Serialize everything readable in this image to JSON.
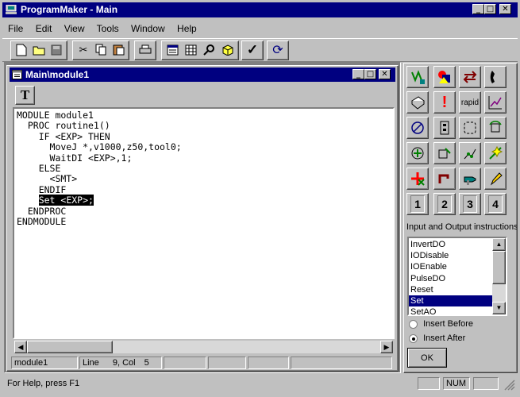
{
  "app": {
    "title": "ProgramMaker - Main"
  },
  "menu": [
    "File",
    "Edit",
    "View",
    "Tools",
    "Window",
    "Help"
  ],
  "toolbar": {
    "icons": [
      "new-file-icon",
      "open-folder-icon",
      "save-icon",
      "cut-icon",
      "copy-icon",
      "paste-icon",
      "print-icon",
      "properties-icon",
      "table-icon",
      "find-icon",
      "package-icon",
      "check-icon",
      "refresh-icon"
    ]
  },
  "child_window": {
    "title": "Main\\module1",
    "tool_letter": "T",
    "code_lines": [
      "MODULE module1",
      "  PROC routine1()",
      "    IF <EXP> THEN",
      "      MoveJ *,v1000,z50,tool0;",
      "      WaitDI <EXP>,1;",
      "    ELSE",
      "      <SMT>",
      "    ENDIF",
      "    Set <EXP>;",
      "  ENDPROC",
      "ENDMODULE"
    ],
    "highlight_line": 8,
    "status": {
      "module": "module1",
      "line_label": "Line",
      "position": "9, Col",
      "col": "5"
    }
  },
  "palette": {
    "rapid_label": "rapid",
    "numbers": [
      "1",
      "2",
      "3",
      "4"
    ],
    "category": "Input and Output instructions",
    "instructions": [
      "InvertDO",
      "IODisable",
      "IOEnable",
      "PulseDO",
      "Reset",
      "Set",
      "SetAO"
    ],
    "selected_index": 5,
    "insert_before": "Insert Before",
    "insert_after": "Insert After",
    "ok_label": "OK"
  },
  "statusbar": {
    "help": "For Help, press F1",
    "num": "NUM"
  }
}
